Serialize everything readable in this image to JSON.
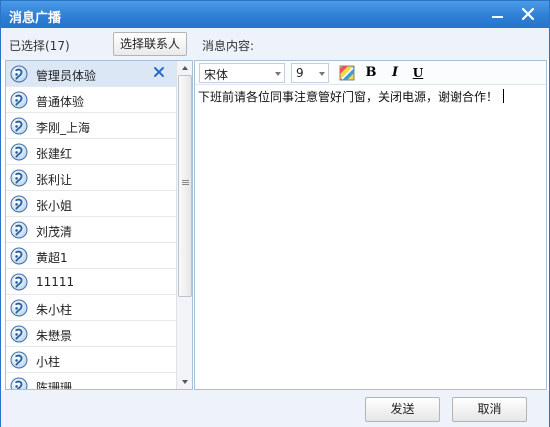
{
  "window": {
    "title": "消息广播"
  },
  "toprow": {
    "selected_label": "已选择(17)",
    "choose_button": "选择联系人",
    "content_label": "消息内容:"
  },
  "contacts": [
    {
      "name": "管理员体验",
      "selected": true
    },
    {
      "name": "普通体验"
    },
    {
      "name": "李刚_上海"
    },
    {
      "name": "张建红"
    },
    {
      "name": "张利让"
    },
    {
      "name": "张小姐"
    },
    {
      "name": "刘茂清"
    },
    {
      "name": "黄超1"
    },
    {
      "name": "11111"
    },
    {
      "name": "朱小柱"
    },
    {
      "name": "朱懋景"
    },
    {
      "name": "小柱"
    },
    {
      "name": "陈珊珊"
    }
  ],
  "toolbar": {
    "font_value": "宋体",
    "size_value": "9",
    "bold_label": "B",
    "italic_label": "I",
    "underline_label": "U"
  },
  "editor": {
    "text": "下班前请各位同事注意管好门窗，关闭电源，谢谢合作！"
  },
  "buttons": {
    "send": "发送",
    "cancel": "取消"
  },
  "colors": {
    "titlebar": "#2e7fd6",
    "accent": "#2a74c6",
    "selected_row": "#dbe7f5"
  }
}
